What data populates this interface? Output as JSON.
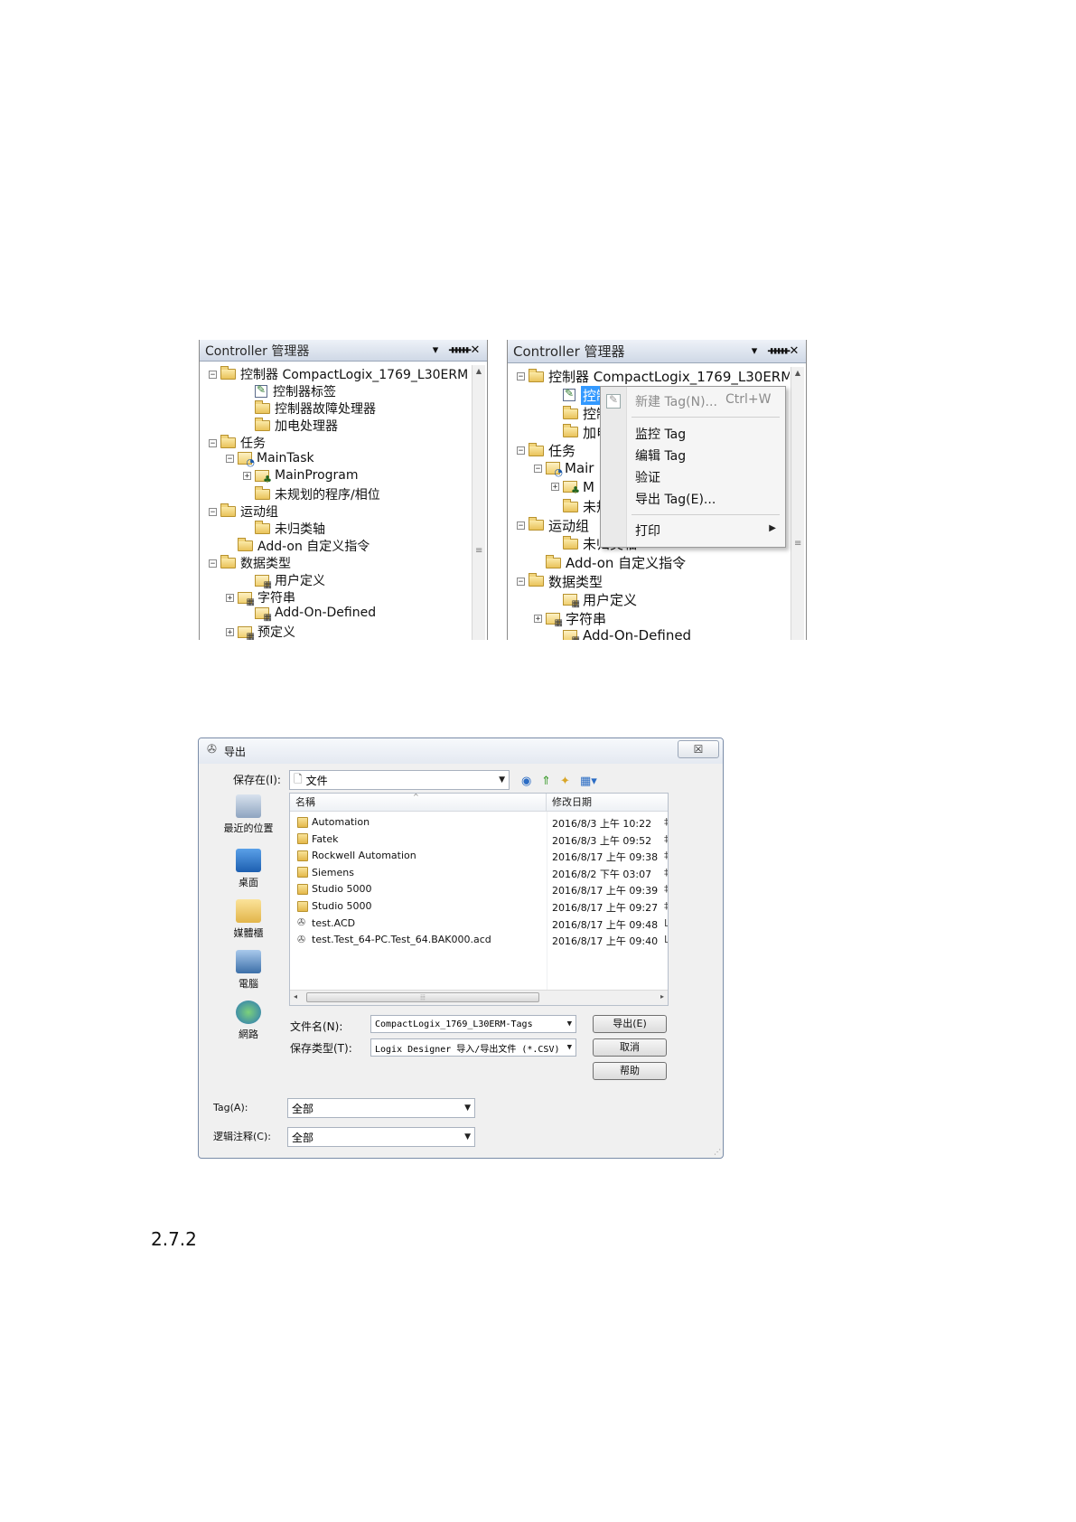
{
  "left_panel": {
    "title": "Controller 管理器",
    "tree": [
      {
        "label": "控制器 CompactLogix_1769_L30ERM",
        "icon": "folder-icon",
        "exp": "−"
      },
      {
        "label": "控制器标签",
        "icon": "tag-icon"
      },
      {
        "label": "控制器故障处理器",
        "icon": "folder-icon"
      },
      {
        "label": "加电处理器",
        "icon": "folder-icon"
      },
      {
        "label": "任务",
        "icon": "folder-icon",
        "exp": "−"
      },
      {
        "label": "MainTask",
        "icon": "task-icon",
        "exp": "−"
      },
      {
        "label": "MainProgram",
        "icon": "program-icon",
        "exp": "+"
      },
      {
        "label": "未规划的程序/相位",
        "icon": "folder-icon"
      },
      {
        "label": "运动组",
        "icon": "folder-icon",
        "exp": "−"
      },
      {
        "label": "未归类轴",
        "icon": "folder-icon"
      },
      {
        "label": "Add-on 自定义指令",
        "icon": "folder-icon"
      },
      {
        "label": "数据类型",
        "icon": "folder-icon",
        "exp": "−"
      },
      {
        "label": "用户定义",
        "icon": "datatype-icon"
      },
      {
        "label": "字符串",
        "icon": "datatype-icon",
        "exp": "+"
      },
      {
        "label": "Add-On-Defined",
        "icon": "datatype-icon"
      },
      {
        "label": "预定义",
        "icon": "datatype-icon",
        "exp": "+"
      }
    ]
  },
  "right_panel": {
    "title": "Controller 管理器",
    "tree": [
      {
        "label": "控制器 CompactLogix_1769_L30ERM",
        "icon": "folder-icon",
        "exp": "−"
      },
      {
        "label": "控制",
        "icon": "tag-icon",
        "selected": true
      },
      {
        "label": "控制",
        "icon": "folder-icon"
      },
      {
        "label": "加电",
        "icon": "folder-icon"
      },
      {
        "label": "任务",
        "icon": "folder-icon",
        "exp": "−"
      },
      {
        "label": "Mair",
        "icon": "task-icon",
        "exp": "−"
      },
      {
        "label": "M",
        "icon": "program-icon",
        "exp": "+"
      },
      {
        "label": "未规",
        "icon": "folder-icon"
      },
      {
        "label": "运动组",
        "icon": "folder-icon",
        "exp": "−"
      },
      {
        "label": "未归类轴",
        "icon": "folder-icon"
      },
      {
        "label": "Add-on 自定义指令",
        "icon": "folder-icon"
      },
      {
        "label": "数据类型",
        "icon": "folder-icon",
        "exp": "−"
      },
      {
        "label": "用户定义",
        "icon": "datatype-icon"
      },
      {
        "label": "字符串",
        "icon": "datatype-icon",
        "exp": "+"
      },
      {
        "label": "Add-On-Defined",
        "icon": "datatype-icon"
      }
    ],
    "context_menu": {
      "new_tag": "新建 Tag(N)...",
      "new_tag_shortcut": "Ctrl+W",
      "monitor_tag": "监控 Tag",
      "edit_tag": "编辑 Tag",
      "verify": "验证",
      "export_tag": "导出 Tag(E)...",
      "print": "打印"
    }
  },
  "dialog": {
    "title": "导出",
    "close_label": "☒",
    "save_in_label": "保存在(I):",
    "save_in_value": "文件",
    "places": [
      "最近的位置",
      "桌面",
      "媒體櫃",
      "電腦",
      "網路"
    ],
    "columns": {
      "name": "名稱",
      "date": "修改日期"
    },
    "files": [
      {
        "name": "Automation",
        "date": "2016/8/3 上午 10:22",
        "type": "folder",
        "tail": "‡"
      },
      {
        "name": "Fatek",
        "date": "2016/8/3 上午 09:52",
        "type": "folder",
        "tail": "‡"
      },
      {
        "name": "Rockwell Automation",
        "date": "2016/8/17 上午 09:38",
        "type": "folder",
        "tail": "‡"
      },
      {
        "name": "Siemens",
        "date": "2016/8/2 下午 03:07",
        "type": "folder",
        "tail": "‡"
      },
      {
        "name": "Studio 5000",
        "date": "2016/8/17 上午 09:39",
        "type": "folder",
        "tail": "‡"
      },
      {
        "name": "Studio 5000",
        "date": "2016/8/17 上午 09:27",
        "type": "folder",
        "tail": "‡"
      },
      {
        "name": "test.ACD",
        "date": "2016/8/17 上午 09:48",
        "type": "file",
        "tail": "L"
      },
      {
        "name": "test.Test_64-PC.Test_64.BAK000.acd",
        "date": "2016/8/17 上午 09:40",
        "type": "file",
        "tail": "L"
      }
    ],
    "filename_label": "文件名(N):",
    "filename_value": "CompactLogix_1769_L30ERM-Tags",
    "filetype_label": "保存类型(T):",
    "filetype_value": "Logix Designer 导入/导出文件 (*.CSV)",
    "export_button": "导出(E)",
    "cancel_button": "取消",
    "help_button": "帮助",
    "tag_label": "Tag(A):",
    "tag_value": "全部",
    "comment_label": "逻辑注释(C):",
    "comment_value": "全部"
  },
  "section_heading": "2.7.2"
}
